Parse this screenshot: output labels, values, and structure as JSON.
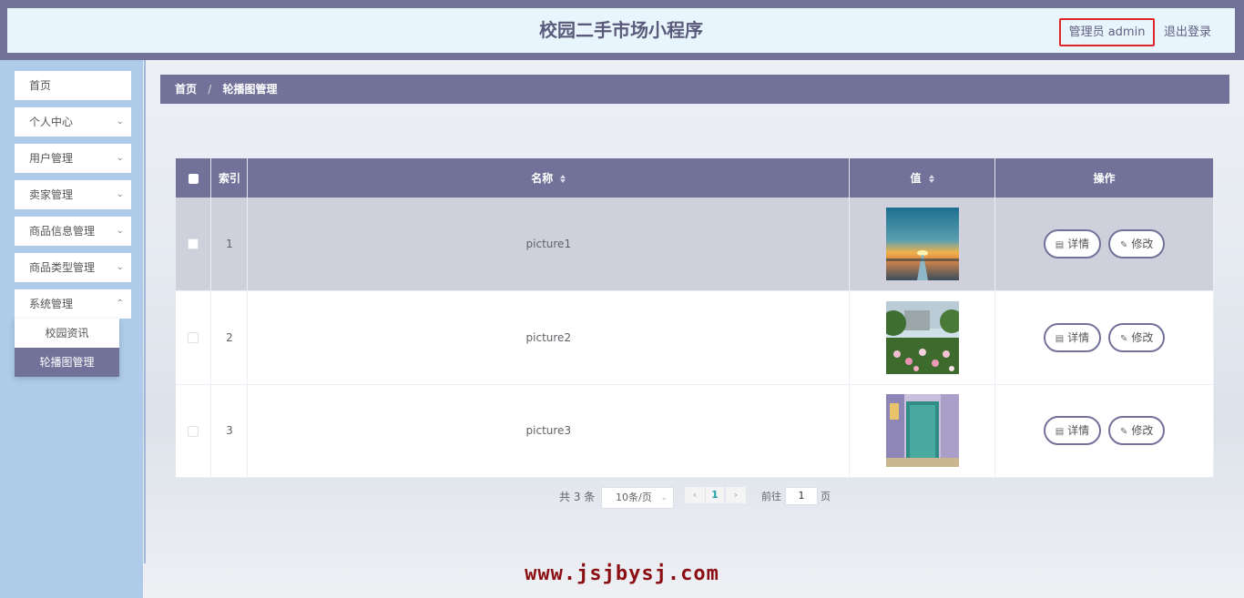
{
  "header": {
    "title": "校园二手市场小程序",
    "admin_label": "管理员 admin",
    "logout_label": "退出登录"
  },
  "sidebar": {
    "items": [
      {
        "label": "首页",
        "has_children": false
      },
      {
        "label": "个人中心",
        "has_children": true
      },
      {
        "label": "用户管理",
        "has_children": true
      },
      {
        "label": "卖家管理",
        "has_children": true
      },
      {
        "label": "商品信息管理",
        "has_children": true
      },
      {
        "label": "商品类型管理",
        "has_children": true
      },
      {
        "label": "系统管理",
        "has_children": true
      }
    ],
    "submenu": [
      {
        "label": "校园资讯",
        "active": false
      },
      {
        "label": "轮播图管理",
        "active": true
      }
    ]
  },
  "breadcrumb": {
    "home": "首页",
    "separator": "/",
    "current": "轮播图管理"
  },
  "table": {
    "columns": [
      "索引",
      "名称",
      "值",
      "操作"
    ],
    "rows": [
      {
        "index": "1",
        "name": "picture1",
        "image": "sunset-road"
      },
      {
        "index": "2",
        "name": "picture2",
        "image": "flower-garden"
      },
      {
        "index": "3",
        "name": "picture3",
        "image": "hallway-door"
      }
    ],
    "detail_label": "详情",
    "edit_label": "修改"
  },
  "pagination": {
    "total_label": "共 3 条",
    "page_size": "10条/页",
    "current_page": "1",
    "goto_label": "前往",
    "goto_value": "1",
    "page_suffix": "页"
  },
  "watermark": "www.jsjbysj.com",
  "colors": {
    "accent": "#72719a",
    "sidebar_bg": "#aecce9",
    "header_bg": "#e8f5fd",
    "highlight_row": "#d0d0dc",
    "admin_border": "#e0262a",
    "watermark": "#8b0e12"
  }
}
